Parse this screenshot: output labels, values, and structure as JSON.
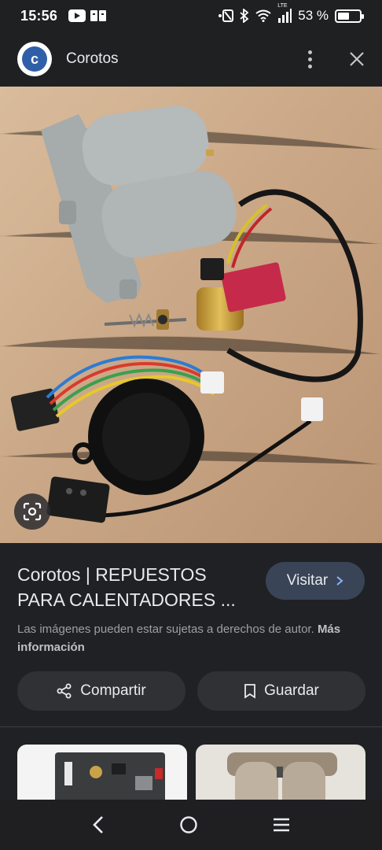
{
  "status_bar": {
    "time": "15:56",
    "battery_text": "53 %",
    "battery_level": 0.53,
    "network_label": "LTE"
  },
  "header": {
    "site_name": "Corotos",
    "logo_letter": "c"
  },
  "result": {
    "title": "Corotos | REPUESTOS PARA CALENTADORES ...",
    "visit_label": "Visitar",
    "copyright_text": "Las imágenes pueden estar sujetas a derechos de autor.",
    "more_info_label": "Más información",
    "share_label": "Compartir",
    "save_label": "Guardar"
  },
  "colors": {
    "background": "#202124",
    "visit_button": "#394457",
    "action_button": "#303134",
    "logo_blue": "#2f5fa8"
  },
  "icons": [
    "youtube-icon",
    "book-icon",
    "nfc-icon",
    "bluetooth-icon",
    "wifi-icon",
    "signal-icon",
    "battery-icon",
    "kebab-menu-icon",
    "close-icon",
    "google-lens-icon",
    "chevron-right-icon",
    "share-icon",
    "bookmark-icon",
    "back-icon",
    "home-icon",
    "recents-icon"
  ]
}
